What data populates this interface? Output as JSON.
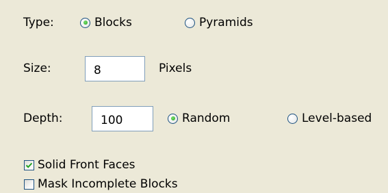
{
  "type": {
    "label": "Type:",
    "options": [
      {
        "label": "Blocks",
        "selected": true
      },
      {
        "label": "Pyramids",
        "selected": false
      }
    ]
  },
  "size": {
    "label": "Size:",
    "value": "8",
    "unit": "Pixels"
  },
  "depth": {
    "label": "Depth:",
    "value": "100",
    "options": [
      {
        "label": "Random",
        "selected": true
      },
      {
        "label": "Level-based",
        "selected": false
      }
    ]
  },
  "checkboxes": [
    {
      "label": "Solid Front Faces",
      "checked": true
    },
    {
      "label": "Mask Incomplete Blocks",
      "checked": false
    }
  ],
  "colors": {
    "panel_bg": "#ece9d8",
    "radio_dot": "#21a121",
    "check_mark": "#21a121",
    "field_border": "#7f9db9",
    "control_border": "#1c5180"
  }
}
